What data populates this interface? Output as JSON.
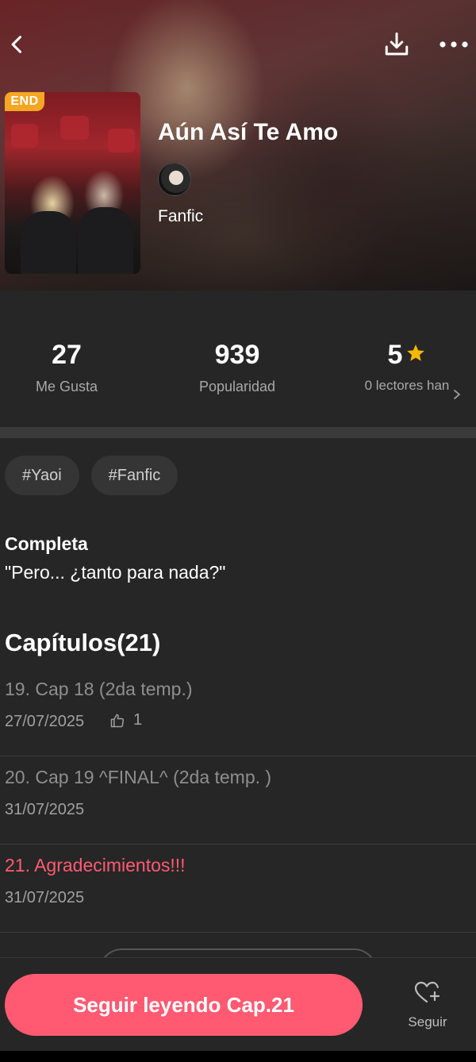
{
  "header": {
    "back_icon": "chevron-left-icon",
    "download_icon": "download-icon",
    "more_icon": "more-horizontal-icon"
  },
  "book": {
    "badge": "END",
    "title": "Aún Así Te Amo",
    "category": "Fanfic"
  },
  "stats": {
    "likes_value": "27",
    "likes_label": "Me Gusta",
    "popularity_value": "939",
    "popularity_label": "Popularidad",
    "rating_value": "5",
    "rating_label": "0 lectores han",
    "rating_color": "#f5b800"
  },
  "tags": [
    "#Yaoi",
    "#Fanfic"
  ],
  "synopsis": {
    "status": "Completa",
    "text": "\"Pero... ¿tanto para nada?\""
  },
  "chapters": {
    "heading": "Capítulos(21)",
    "items": [
      {
        "title": "19. Cap 18 (2da temp.)",
        "date": "27/07/2025",
        "likes": "1"
      },
      {
        "title": "20. Cap 19 ^FINAL^ (2da temp. )",
        "date": "31/07/2025"
      },
      {
        "title": "21. Agradecimientos!!!",
        "date": "31/07/2025"
      }
    ]
  },
  "bottom": {
    "cta_label": "Seguir leyendo Cap.21",
    "follow_label": "Seguir",
    "accent_color": "#ff5a72"
  }
}
